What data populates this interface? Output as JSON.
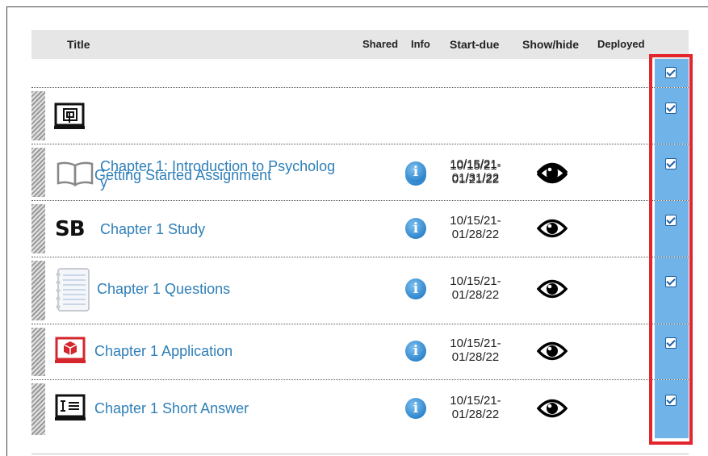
{
  "columns": {
    "title": "Title",
    "shared": "Shared",
    "info": "Info",
    "start_due": "Start-due",
    "show_hide": "Show/hide",
    "deployed": "Deployed"
  },
  "assignments": [
    {
      "title": "Getting Started Assignment",
      "icon": "computer-assignment-icon",
      "start": "10/15/21-",
      "due": "01/21/22",
      "deployed": true
    },
    {
      "title_line1": "Chapter 1: Introduction to Psycholog",
      "title_line2": "y",
      "icon": "open-book-icon",
      "start": "10/15/21-",
      "due": "01/31/22",
      "deployed": true
    },
    {
      "title": "Chapter 1 Study",
      "icon": "smartbook-icon",
      "icon_text": "SB",
      "start": "10/15/21-",
      "due": "01/28/22",
      "deployed": true
    },
    {
      "title": "Chapter 1 Questions",
      "icon": "notebook-icon",
      "start": "10/15/21-",
      "due": "01/28/22",
      "deployed": true
    },
    {
      "title": "Chapter 1 Application",
      "icon": "application-cube-icon",
      "start": "10/15/21-",
      "due": "01/28/22",
      "deployed": true
    },
    {
      "title": "Chapter 1 Short Answer",
      "icon": "short-answer-icon",
      "start": "10/15/21-",
      "due": "01/28/22",
      "deployed": true
    }
  ],
  "select_all_deployed": true,
  "info_glyph": "i",
  "colors": {
    "link": "#2f7fb8",
    "deployed_column": "#6fb3e8",
    "highlight": "#e3262e",
    "info": "#2f86cc"
  }
}
